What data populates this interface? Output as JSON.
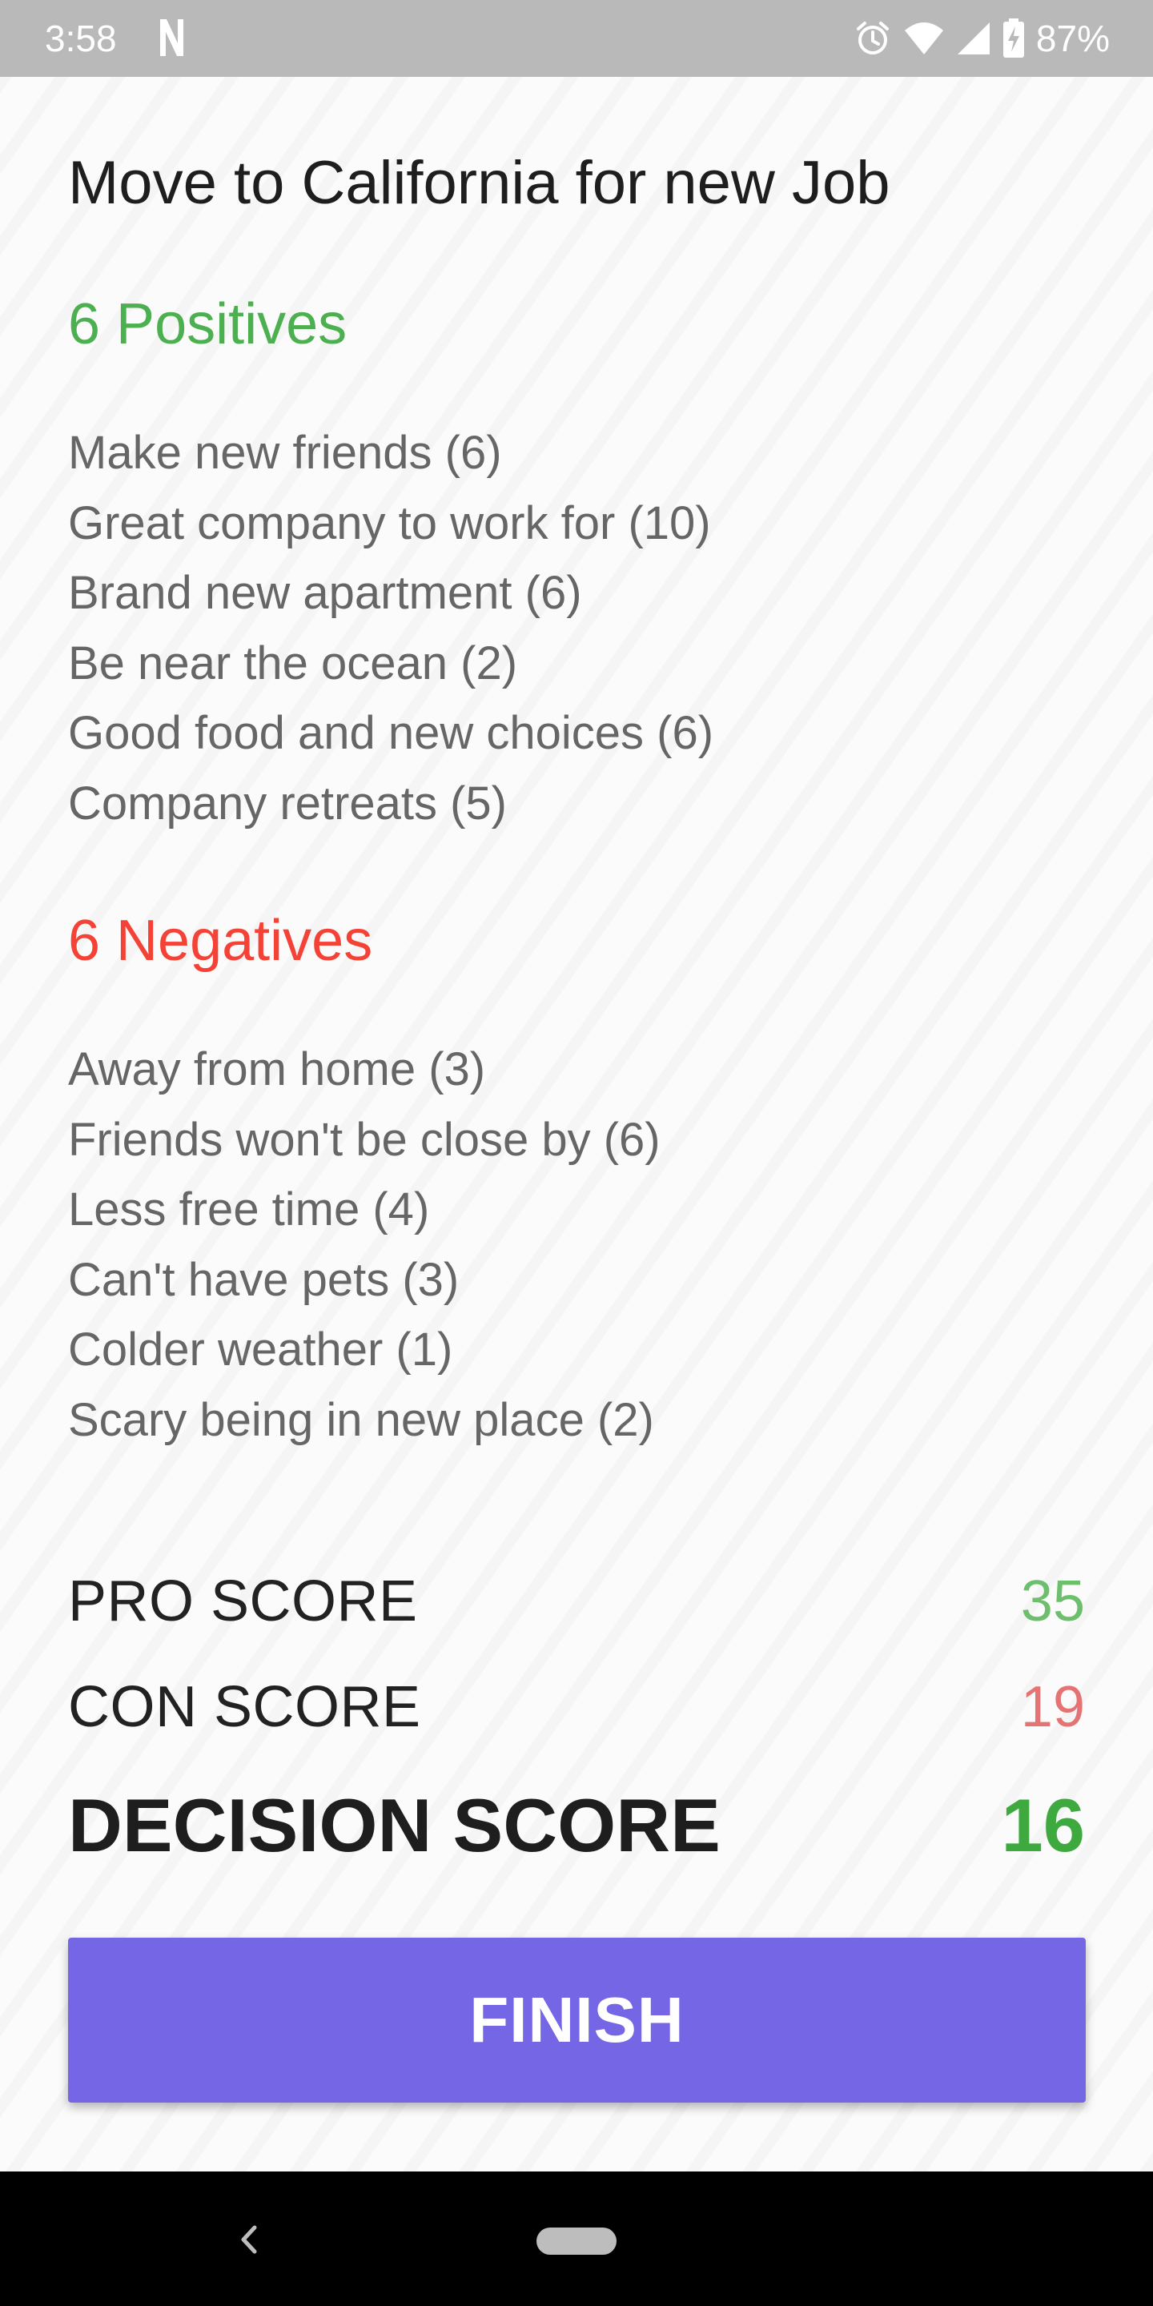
{
  "status_bar": {
    "time": "3:58",
    "battery_percent": "87%",
    "icons": [
      "n-icon",
      "alarm-icon",
      "wifi-icon",
      "signal-icon",
      "battery-charging-icon"
    ]
  },
  "decision": {
    "title": "Move to California for new Job"
  },
  "positives": {
    "heading": "6 Positives",
    "color": "#4caf50",
    "items": [
      "Make new friends (6)",
      "Great company to work for (10)",
      "Brand new apartment (6)",
      "Be near the ocean (2)",
      "Good food and new choices (6)",
      "Company retreats (5)"
    ]
  },
  "negatives": {
    "heading": "6 Negatives",
    "color": "#f44336",
    "items": [
      "Away from home (3)",
      "Friends won't be close by (6)",
      "Less free time (4)",
      "Can't have pets (3)",
      "Colder weather (1)",
      "Scary being in new place (2)"
    ]
  },
  "scores": {
    "pro_label": "PRO SCORE",
    "pro_value": "35",
    "con_label": "CON SCORE",
    "con_value": "19",
    "decision_label": "DECISION SCORE",
    "decision_value": "16"
  },
  "actions": {
    "finish_label": "FINISH",
    "accent_color": "#7566e6"
  },
  "nav_bar": {
    "icons": [
      "back-icon",
      "home-pill-icon"
    ]
  }
}
